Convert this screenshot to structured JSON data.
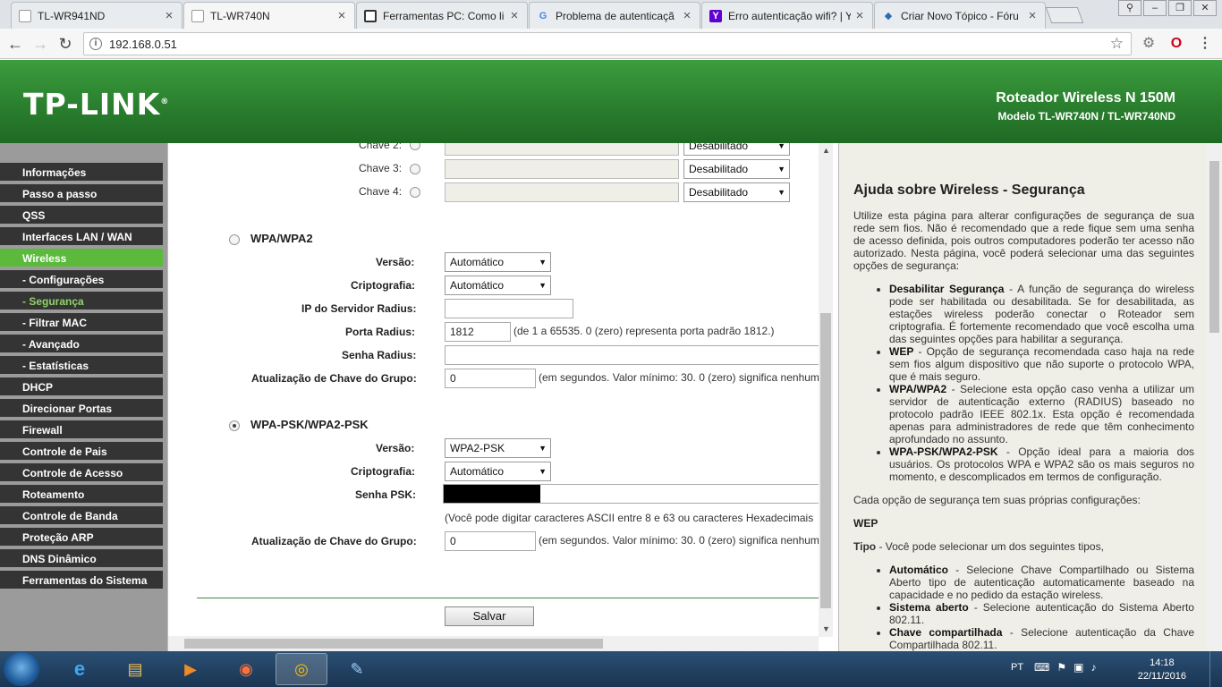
{
  "browser": {
    "tabs": [
      {
        "title": "TL-WR941ND",
        "active": false
      },
      {
        "title": "TL-WR740N",
        "active": true
      },
      {
        "title": "Ferramentas PC: Como li",
        "active": false
      },
      {
        "title": "Problema de autenticaçã",
        "active": false
      },
      {
        "title": "Erro autenticação wifi? | Y",
        "active": false
      },
      {
        "title": "Criar Novo Tópico - Fóru",
        "active": false
      }
    ],
    "url": "192.168.0.51"
  },
  "header": {
    "logo": "TP-LINK",
    "logo_mark": "®",
    "product_line1": "Roteador Wireless N 150M",
    "product_line2": "Modelo TL-WR740N / TL-WR740ND"
  },
  "sidebar": {
    "items": [
      {
        "label": "Informações"
      },
      {
        "label": "Passo a passo"
      },
      {
        "label": "QSS"
      },
      {
        "label": "Interfaces LAN / WAN"
      },
      {
        "label": "Wireless"
      },
      {
        "label": "- Configurações"
      },
      {
        "label": "- Segurança"
      },
      {
        "label": "- Filtrar MAC"
      },
      {
        "label": "- Avançado"
      },
      {
        "label": "- Estatísticas"
      },
      {
        "label": "DHCP"
      },
      {
        "label": "Direcionar Portas"
      },
      {
        "label": "Firewall"
      },
      {
        "label": "Controle de Pais"
      },
      {
        "label": "Controle de Acesso"
      },
      {
        "label": "Roteamento"
      },
      {
        "label": "Controle de Banda"
      },
      {
        "label": "Proteção ARP"
      },
      {
        "label": "DNS Dinâmico"
      },
      {
        "label": "Ferramentas do Sistema"
      }
    ]
  },
  "wep": {
    "keys": [
      {
        "label": "Chave 2:",
        "type": "Desabilitado"
      },
      {
        "label": "Chave 3:",
        "type": "Desabilitado"
      },
      {
        "label": "Chave 4:",
        "type": "Desabilitado"
      }
    ]
  },
  "wpa": {
    "title": "WPA/WPA2",
    "version_label": "Versão:",
    "version_value": "Automático",
    "crypto_label": "Criptografia:",
    "crypto_value": "Automático",
    "radius_ip_label": "IP do Servidor Radius:",
    "radius_ip_value": "",
    "radius_port_label": "Porta Radius:",
    "radius_port_value": "1812",
    "radius_port_hint": "(de 1 a 65535. 0 (zero) representa porta padrão 1812.)",
    "radius_pass_label": "Senha Radius:",
    "radius_pass_value": "",
    "group_key_label": "Atualização de Chave do Grupo:",
    "group_key_value": "0",
    "group_key_hint": "(em segundos. Valor mínimo: 30. 0 (zero) significa nenhum"
  },
  "psk": {
    "title": "WPA-PSK/WPA2-PSK",
    "version_label": "Versão:",
    "version_value": "WPA2-PSK",
    "crypto_label": "Criptografia:",
    "crypto_value": "Automático",
    "psk_label": "Senha PSK:",
    "psk_hint": "(Você pode digitar caracteres ASCII entre 8 e 63 ou caracteres Hexadecimais",
    "group_key_label": "Atualização de Chave do Grupo:",
    "group_key_value": "0",
    "group_key_hint": "(em segundos. Valor mínimo: 30. 0 (zero) significa nenhum"
  },
  "save_label": "Salvar",
  "help": {
    "title": "Ajuda sobre Wireless - Segurança",
    "intro": "Utilize esta página para alterar configurações de segurança de sua rede sem fios. Não é recomendado que a rede fique sem uma senha de acesso definida, pois outros computadores poderão ter acesso não autorizado. Nesta página, você poderá selecionar uma das seguintes opções de segurança:",
    "options": [
      {
        "name": "Desabilitar Segurança",
        "text": " - A função de segurança do wireless pode ser habilitada ou desabilitada. Se for desabilitada, as estações wireless poderão conectar o Roteador sem criptografia. É fortemente recomendado que você escolha uma das seguintes opções para habilitar a segurança."
      },
      {
        "name": "WEP",
        "text": " - Opção de segurança recomendada caso haja na rede sem fios algum dispositivo que não suporte o protocolo WPA, que é mais seguro."
      },
      {
        "name": "WPA/WPA2",
        "text": " - Selecione esta opção caso venha a utilizar um servidor de autenticação externo (RADIUS) baseado no protocolo padrão IEEE 802.1x. Esta opção é recomendada apenas para administradores de rede que têm conhecimento aprofundado no assunto."
      },
      {
        "name": "WPA-PSK/WPA2-PSK",
        "text": " - Opção ideal para a maioria dos usuários. Os protocolos WPA e WPA2 são os mais seguros no momento, e descomplicados em termos de configuração."
      }
    ],
    "each_option": "Cada opção de segurança tem suas próprias configurações:",
    "wep_heading": "WEP",
    "tipo_label": "Tipo",
    "tipo_text": " - Você pode selecionar um dos seguintes tipos,",
    "types": [
      {
        "name": "Automático",
        "text": " - Selecione Chave Compartilhado ou Sistema Aberto tipo de autenticação automaticamente baseado na capacidade e no pedido da estação wireless."
      },
      {
        "name": "Sistema aberto",
        "text": " - Selecione autenticação do Sistema Aberto 802.11."
      },
      {
        "name": "Chave compartilhada",
        "text": " - Selecione autenticação da Chave Compartilhada 802.11."
      }
    ]
  },
  "taskbar": {
    "lang": "PT",
    "time": "14:18",
    "date": "22/11/2016"
  }
}
